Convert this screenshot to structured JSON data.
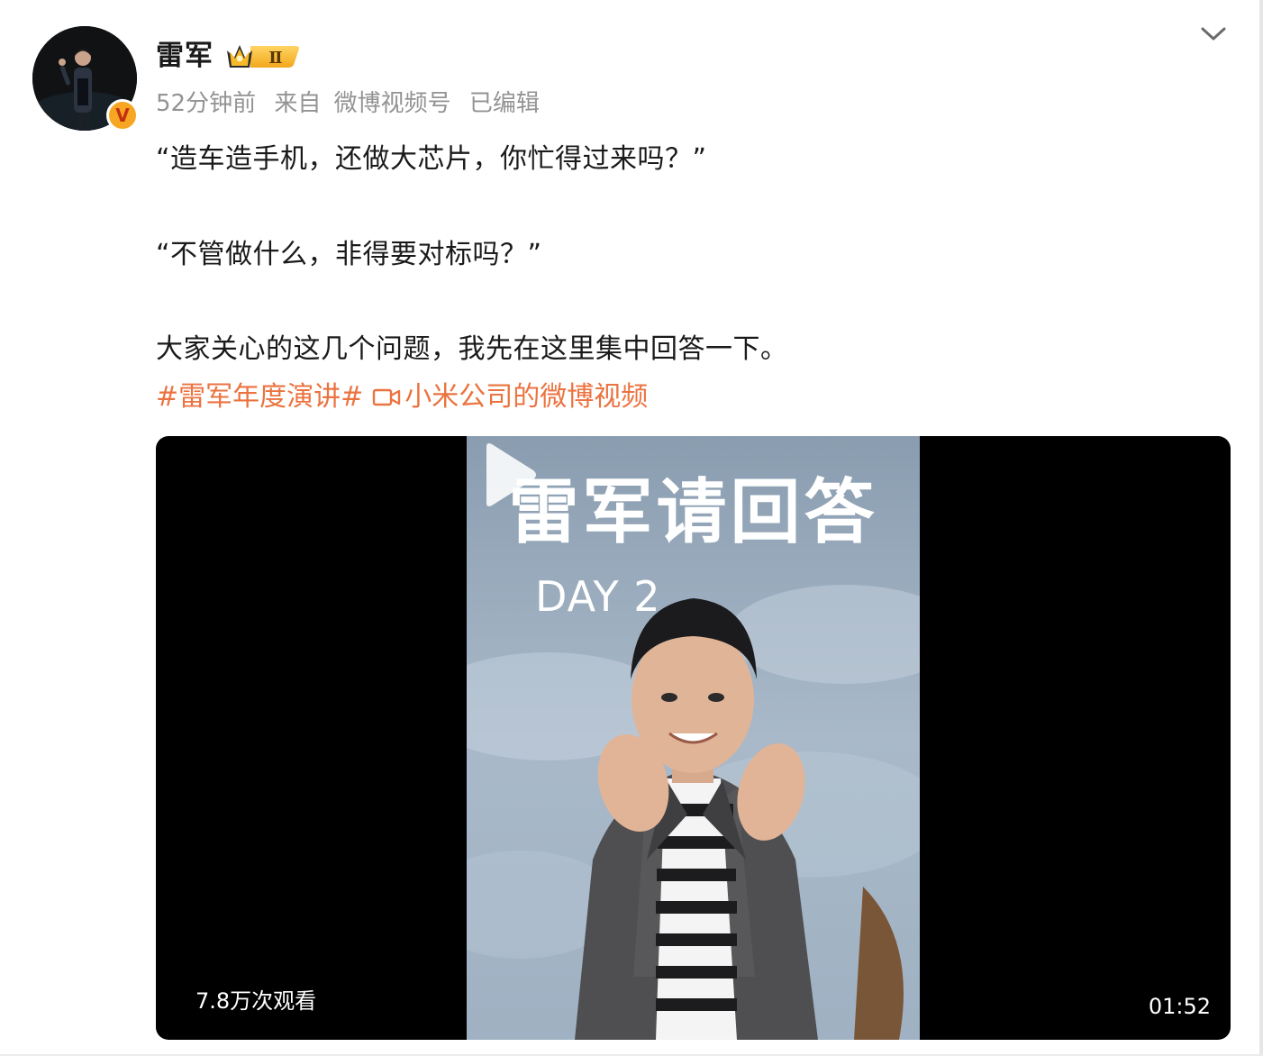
{
  "author": {
    "name": "雷军",
    "verified_badge": "V",
    "level_badge": "Ⅱ"
  },
  "meta": {
    "time": "52分钟前",
    "source_prefix": "来自",
    "source": "微博视频号",
    "edited": "已编辑"
  },
  "post": {
    "lines": [
      "“造车造手机，还做大芯片，你忙得过来吗？”",
      "“不管做什么，非得要对标吗？”",
      "大家关心的这几个问题，我先在这里集中回答一下。"
    ],
    "hashtag": "#雷军年度演讲#",
    "video_link": "小米公司的微博视频"
  },
  "video": {
    "title": "雷军请回答",
    "subtitle": "DAY 2",
    "views": "7.8万次观看",
    "duration": "01:52"
  },
  "icons": {
    "more": "chevron-down-icon",
    "video_link": "video-camera-icon",
    "play": "play-icon",
    "verified": "verified-v-icon",
    "level": "crown-level-icon"
  },
  "colors": {
    "link": "#eb7340",
    "meta": "#939393",
    "text": "#1a1a1a",
    "verified_bg": "#f6a623"
  }
}
